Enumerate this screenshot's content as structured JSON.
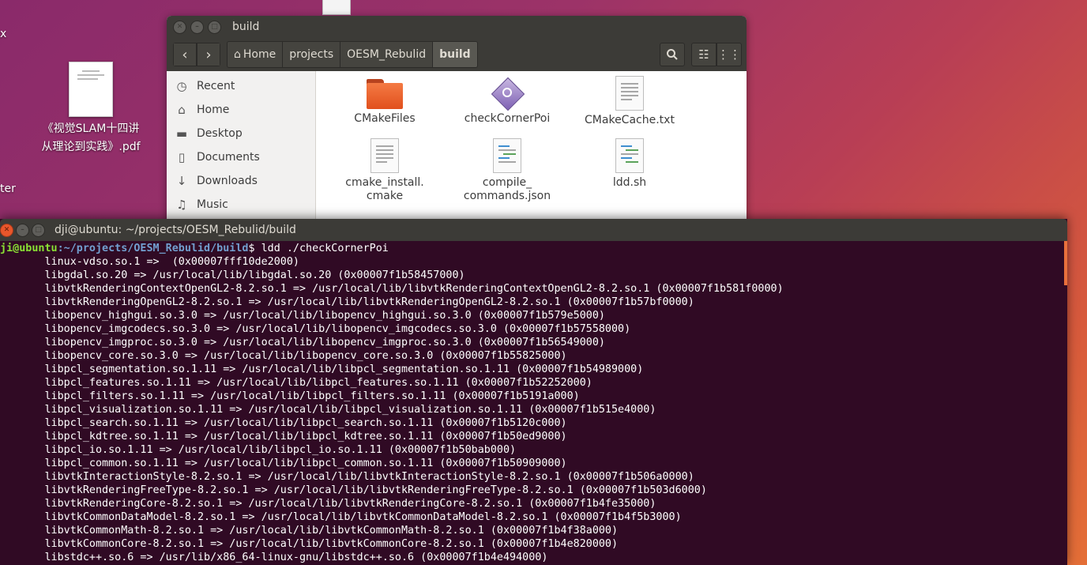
{
  "desktop": {
    "fragments": [
      "x",
      "ter"
    ],
    "pdf_label_line1": "《视觉SLAM十四讲",
    "pdf_label_line2": "从理论到实践》.pdf"
  },
  "files_window": {
    "title": "build",
    "breadcrumbs": [
      "Home",
      "projects",
      "OESM_Rebulid",
      "build"
    ],
    "sidebar": [
      {
        "label": "Recent",
        "icon": "clock-icon"
      },
      {
        "label": "Home",
        "icon": "home-icon"
      },
      {
        "label": "Desktop",
        "icon": "folder-icon"
      },
      {
        "label": "Documents",
        "icon": "document-icon"
      },
      {
        "label": "Downloads",
        "icon": "download-icon"
      },
      {
        "label": "Music",
        "icon": "music-icon"
      }
    ],
    "files": [
      {
        "name": "CMakeFiles",
        "type": "folder"
      },
      {
        "name": "checkCornerPoi",
        "type": "executable"
      },
      {
        "name": "CMakeCache.txt",
        "type": "text"
      },
      {
        "name_line1": "cmake_install.",
        "name_line2": "cmake",
        "type": "text"
      },
      {
        "name_line1": "compile_",
        "name_line2": "commands.json",
        "type": "code"
      },
      {
        "name": "ldd.sh",
        "type": "code"
      }
    ]
  },
  "terminal": {
    "title": "dji@ubuntu: ~/projects/OESM_Rebulid/build",
    "prompt_user": "dji@ubuntu",
    "prompt_path": ":~/projects/OESM_Rebulid/build",
    "command": "$ ldd ./checkCornerPoi",
    "lines": [
      "\tlinux-vdso.so.1 =>  (0x00007fff10de2000)",
      "\tlibgdal.so.20 => /usr/local/lib/libgdal.so.20 (0x00007f1b58457000)",
      "\tlibvtkRenderingContextOpenGL2-8.2.so.1 => /usr/local/lib/libvtkRenderingContextOpenGL2-8.2.so.1 (0x00007f1b581f0000)",
      "\tlibvtkRenderingOpenGL2-8.2.so.1 => /usr/local/lib/libvtkRenderingOpenGL2-8.2.so.1 (0x00007f1b57bf0000)",
      "\tlibopencv_highgui.so.3.0 => /usr/local/lib/libopencv_highgui.so.3.0 (0x00007f1b579e5000)",
      "\tlibopencv_imgcodecs.so.3.0 => /usr/local/lib/libopencv_imgcodecs.so.3.0 (0x00007f1b57558000)",
      "\tlibopencv_imgproc.so.3.0 => /usr/local/lib/libopencv_imgproc.so.3.0 (0x00007f1b56549000)",
      "\tlibopencv_core.so.3.0 => /usr/local/lib/libopencv_core.so.3.0 (0x00007f1b55825000)",
      "\tlibpcl_segmentation.so.1.11 => /usr/local/lib/libpcl_segmentation.so.1.11 (0x00007f1b54989000)",
      "\tlibpcl_features.so.1.11 => /usr/local/lib/libpcl_features.so.1.11 (0x00007f1b52252000)",
      "\tlibpcl_filters.so.1.11 => /usr/local/lib/libpcl_filters.so.1.11 (0x00007f1b5191a000)",
      "\tlibpcl_visualization.so.1.11 => /usr/local/lib/libpcl_visualization.so.1.11 (0x00007f1b515e4000)",
      "\tlibpcl_search.so.1.11 => /usr/local/lib/libpcl_search.so.1.11 (0x00007f1b5120c000)",
      "\tlibpcl_kdtree.so.1.11 => /usr/local/lib/libpcl_kdtree.so.1.11 (0x00007f1b50ed9000)",
      "\tlibpcl_io.so.1.11 => /usr/local/lib/libpcl_io.so.1.11 (0x00007f1b50bab000)",
      "\tlibpcl_common.so.1.11 => /usr/local/lib/libpcl_common.so.1.11 (0x00007f1b50909000)",
      "\tlibvtkInteractionStyle-8.2.so.1 => /usr/local/lib/libvtkInteractionStyle-8.2.so.1 (0x00007f1b506a0000)",
      "\tlibvtkRenderingFreeType-8.2.so.1 => /usr/local/lib/libvtkRenderingFreeType-8.2.so.1 (0x00007f1b503d6000)",
      "\tlibvtkRenderingCore-8.2.so.1 => /usr/local/lib/libvtkRenderingCore-8.2.so.1 (0x00007f1b4fe35000)",
      "\tlibvtkCommonDataModel-8.2.so.1 => /usr/local/lib/libvtkCommonDataModel-8.2.so.1 (0x00007f1b4f5b3000)",
      "\tlibvtkCommonMath-8.2.so.1 => /usr/local/lib/libvtkCommonMath-8.2.so.1 (0x00007f1b4f38a000)",
      "\tlibvtkCommonCore-8.2.so.1 => /usr/local/lib/libvtkCommonCore-8.2.so.1 (0x00007f1b4e820000)",
      "\tlibstdc++.so.6 => /usr/lib/x86_64-linux-gnu/libstdc++.so.6 (0x00007f1b4e494000)"
    ]
  },
  "colors": {
    "prompt_user": "#8ae234",
    "prompt_path": "#729fcf",
    "terminal_bg": "#300a24",
    "ubuntu_orange": "#e9562b"
  }
}
